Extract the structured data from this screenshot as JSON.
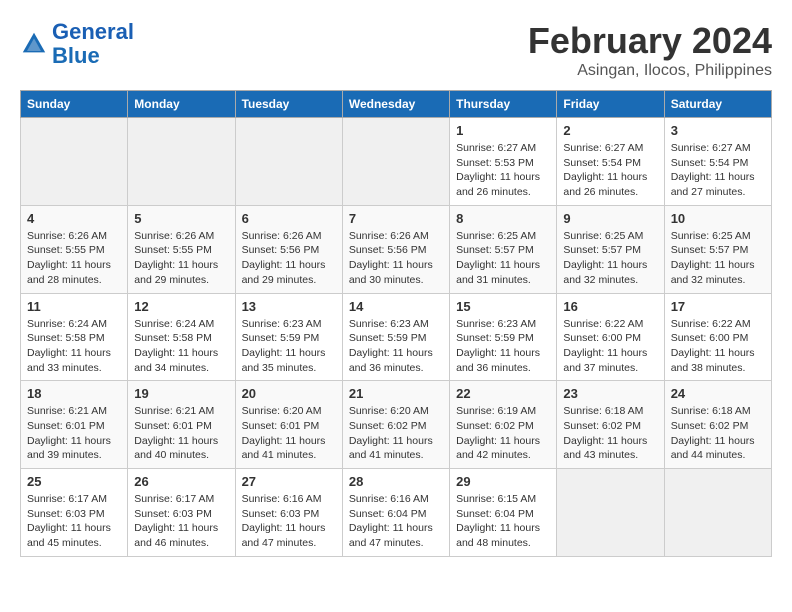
{
  "header": {
    "logo_general": "General",
    "logo_blue": "Blue",
    "month_title": "February 2024",
    "subtitle": "Asingan, Ilocos, Philippines"
  },
  "days_of_week": [
    "Sunday",
    "Monday",
    "Tuesday",
    "Wednesday",
    "Thursday",
    "Friday",
    "Saturday"
  ],
  "weeks": [
    [
      {
        "day": "",
        "info": ""
      },
      {
        "day": "",
        "info": ""
      },
      {
        "day": "",
        "info": ""
      },
      {
        "day": "",
        "info": ""
      },
      {
        "day": "1",
        "info": "Sunrise: 6:27 AM\nSunset: 5:53 PM\nDaylight: 11 hours and 26 minutes."
      },
      {
        "day": "2",
        "info": "Sunrise: 6:27 AM\nSunset: 5:54 PM\nDaylight: 11 hours and 26 minutes."
      },
      {
        "day": "3",
        "info": "Sunrise: 6:27 AM\nSunset: 5:54 PM\nDaylight: 11 hours and 27 minutes."
      }
    ],
    [
      {
        "day": "4",
        "info": "Sunrise: 6:26 AM\nSunset: 5:55 PM\nDaylight: 11 hours and 28 minutes."
      },
      {
        "day": "5",
        "info": "Sunrise: 6:26 AM\nSunset: 5:55 PM\nDaylight: 11 hours and 29 minutes."
      },
      {
        "day": "6",
        "info": "Sunrise: 6:26 AM\nSunset: 5:56 PM\nDaylight: 11 hours and 29 minutes."
      },
      {
        "day": "7",
        "info": "Sunrise: 6:26 AM\nSunset: 5:56 PM\nDaylight: 11 hours and 30 minutes."
      },
      {
        "day": "8",
        "info": "Sunrise: 6:25 AM\nSunset: 5:57 PM\nDaylight: 11 hours and 31 minutes."
      },
      {
        "day": "9",
        "info": "Sunrise: 6:25 AM\nSunset: 5:57 PM\nDaylight: 11 hours and 32 minutes."
      },
      {
        "day": "10",
        "info": "Sunrise: 6:25 AM\nSunset: 5:57 PM\nDaylight: 11 hours and 32 minutes."
      }
    ],
    [
      {
        "day": "11",
        "info": "Sunrise: 6:24 AM\nSunset: 5:58 PM\nDaylight: 11 hours and 33 minutes."
      },
      {
        "day": "12",
        "info": "Sunrise: 6:24 AM\nSunset: 5:58 PM\nDaylight: 11 hours and 34 minutes."
      },
      {
        "day": "13",
        "info": "Sunrise: 6:23 AM\nSunset: 5:59 PM\nDaylight: 11 hours and 35 minutes."
      },
      {
        "day": "14",
        "info": "Sunrise: 6:23 AM\nSunset: 5:59 PM\nDaylight: 11 hours and 36 minutes."
      },
      {
        "day": "15",
        "info": "Sunrise: 6:23 AM\nSunset: 5:59 PM\nDaylight: 11 hours and 36 minutes."
      },
      {
        "day": "16",
        "info": "Sunrise: 6:22 AM\nSunset: 6:00 PM\nDaylight: 11 hours and 37 minutes."
      },
      {
        "day": "17",
        "info": "Sunrise: 6:22 AM\nSunset: 6:00 PM\nDaylight: 11 hours and 38 minutes."
      }
    ],
    [
      {
        "day": "18",
        "info": "Sunrise: 6:21 AM\nSunset: 6:01 PM\nDaylight: 11 hours and 39 minutes."
      },
      {
        "day": "19",
        "info": "Sunrise: 6:21 AM\nSunset: 6:01 PM\nDaylight: 11 hours and 40 minutes."
      },
      {
        "day": "20",
        "info": "Sunrise: 6:20 AM\nSunset: 6:01 PM\nDaylight: 11 hours and 41 minutes."
      },
      {
        "day": "21",
        "info": "Sunrise: 6:20 AM\nSunset: 6:02 PM\nDaylight: 11 hours and 41 minutes."
      },
      {
        "day": "22",
        "info": "Sunrise: 6:19 AM\nSunset: 6:02 PM\nDaylight: 11 hours and 42 minutes."
      },
      {
        "day": "23",
        "info": "Sunrise: 6:18 AM\nSunset: 6:02 PM\nDaylight: 11 hours and 43 minutes."
      },
      {
        "day": "24",
        "info": "Sunrise: 6:18 AM\nSunset: 6:02 PM\nDaylight: 11 hours and 44 minutes."
      }
    ],
    [
      {
        "day": "25",
        "info": "Sunrise: 6:17 AM\nSunset: 6:03 PM\nDaylight: 11 hours and 45 minutes."
      },
      {
        "day": "26",
        "info": "Sunrise: 6:17 AM\nSunset: 6:03 PM\nDaylight: 11 hours and 46 minutes."
      },
      {
        "day": "27",
        "info": "Sunrise: 6:16 AM\nSunset: 6:03 PM\nDaylight: 11 hours and 47 minutes."
      },
      {
        "day": "28",
        "info": "Sunrise: 6:16 AM\nSunset: 6:04 PM\nDaylight: 11 hours and 47 minutes."
      },
      {
        "day": "29",
        "info": "Sunrise: 6:15 AM\nSunset: 6:04 PM\nDaylight: 11 hours and 48 minutes."
      },
      {
        "day": "",
        "info": ""
      },
      {
        "day": "",
        "info": ""
      }
    ]
  ]
}
